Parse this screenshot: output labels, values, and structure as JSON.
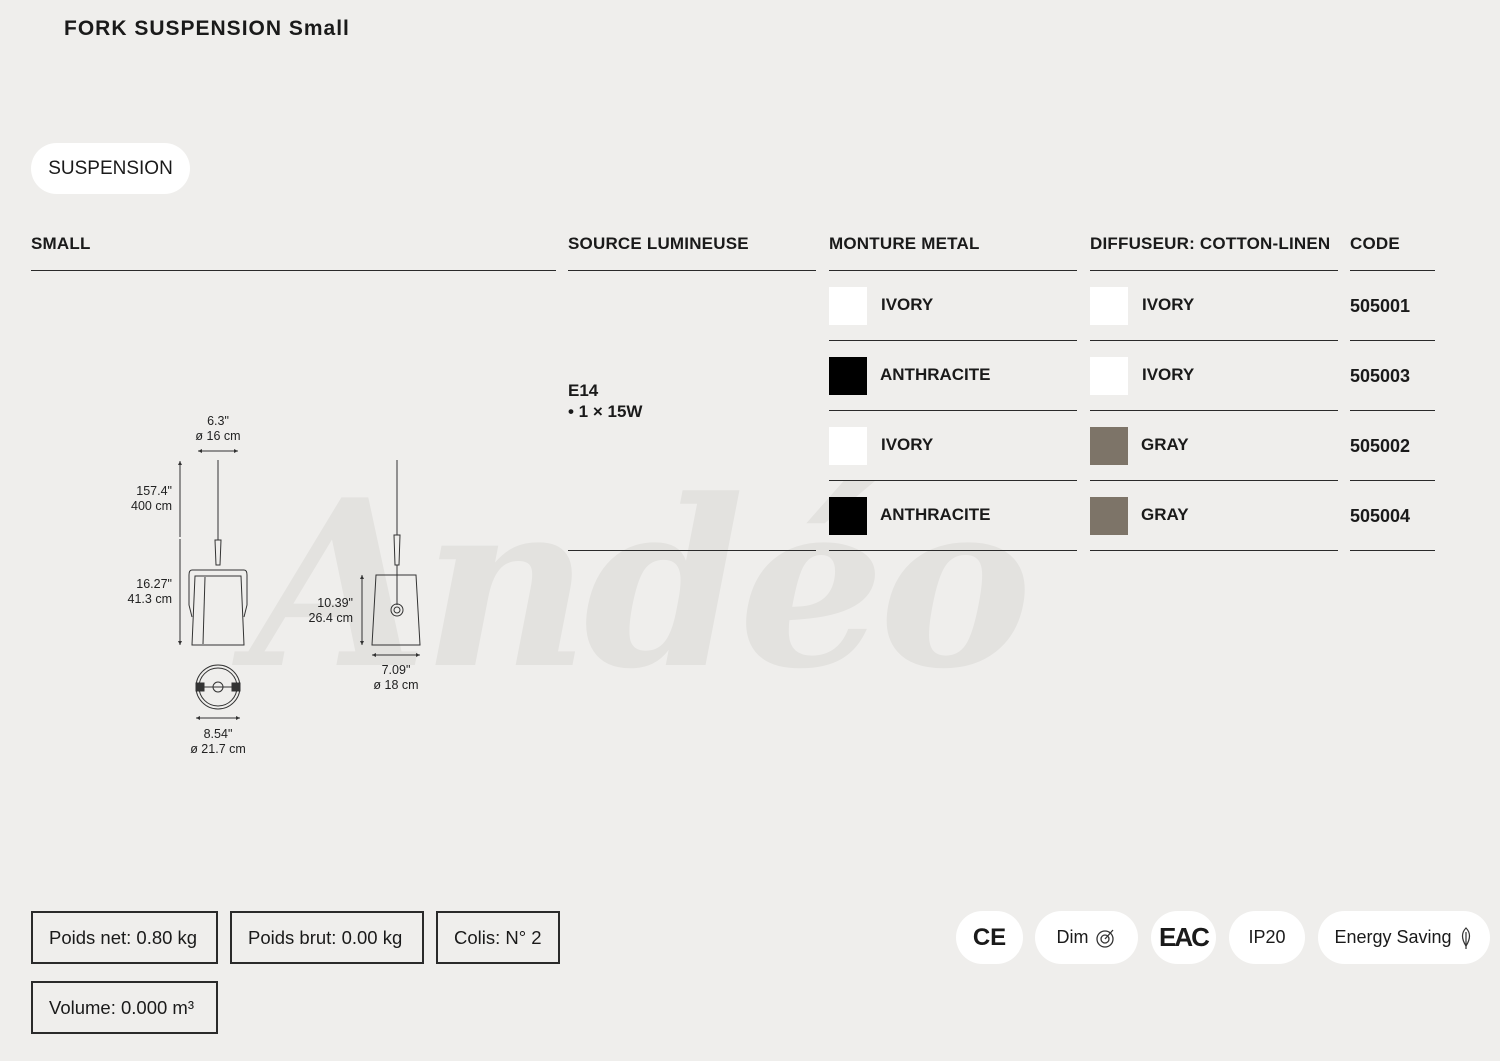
{
  "title": "FORK SUSPENSION Small",
  "category": "SUSPENSION",
  "watermark": "Andéo",
  "table": {
    "headers": {
      "model": "SMALL",
      "source": "SOURCE LUMINEUSE",
      "metal": "MONTURE METAL",
      "diffuser": "DIFFUSEUR: COTTON-LINEN",
      "code": "CODE"
    },
    "source_line1": "E14",
    "source_line2": "• 1 × 15W",
    "rows": [
      {
        "metal": "IVORY",
        "metal_color": "#ffffff",
        "diffuser": "IVORY",
        "diffuser_color": "#ffffff",
        "code": "505001"
      },
      {
        "metal": "ANTHRACITE",
        "metal_color": "#000000",
        "diffuser": "IVORY",
        "diffuser_color": "#ffffff",
        "code": "505003"
      },
      {
        "metal": "IVORY",
        "metal_color": "#ffffff",
        "diffuser": "GRAY",
        "diffuser_color": "#7d7468",
        "code": "505002"
      },
      {
        "metal": "ANTHRACITE",
        "metal_color": "#000000",
        "diffuser": "GRAY",
        "diffuser_color": "#7d7468",
        "code": "505004"
      }
    ]
  },
  "dimensions": {
    "top_width_in": "6.3\"",
    "top_width_cm": "ø 16 cm",
    "cable_in": "157.4\"",
    "cable_cm": "400 cm",
    "body_h_in": "16.27\"",
    "body_h_cm": "41.3 cm",
    "base_w_in": "8.54\"",
    "base_w_cm": "ø 21.7 cm",
    "shade_h_in": "10.39\"",
    "shade_h_cm": "26.4 cm",
    "shade_w_in": "7.09\"",
    "shade_w_cm": "ø 18 cm"
  },
  "specs": {
    "poids_net": "Poids net: 0.80 kg",
    "poids_brut": "Poids brut: 0.00 kg",
    "colis": "Colis: N° 2",
    "volume": "Volume: 0.000 m³"
  },
  "badges": {
    "ce": "CE",
    "dim": "Dim",
    "eac": "EAC",
    "ip": "IP20",
    "energy": "Energy Saving"
  }
}
